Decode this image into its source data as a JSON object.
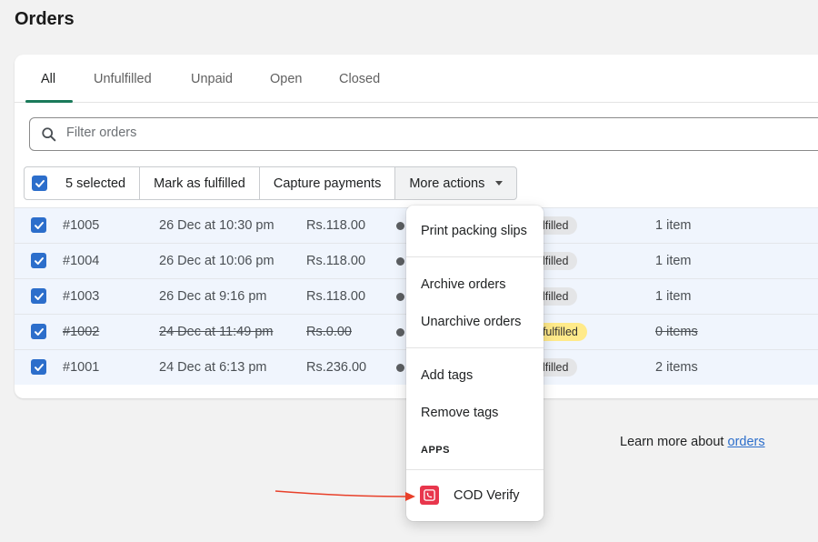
{
  "page": {
    "title": "Orders"
  },
  "tabs": [
    {
      "label": "All",
      "active": true
    },
    {
      "label": "Unfulfilled",
      "active": false
    },
    {
      "label": "Unpaid",
      "active": false
    },
    {
      "label": "Open",
      "active": false
    },
    {
      "label": "Closed",
      "active": false
    }
  ],
  "filter": {
    "placeholder": "Filter orders",
    "icon": "search-icon"
  },
  "bulk_actions": {
    "selected_label": "5 selected",
    "mark_fulfilled_label": "Mark as fulfilled",
    "capture_payments_label": "Capture payments",
    "more_actions_label": "More actions"
  },
  "orders": [
    {
      "id": "#1005",
      "date": "26 Dec at 10:30 pm",
      "total": "Rs.118.00",
      "fulfillment": "ulfilled",
      "items": "1 item",
      "checked": true,
      "struck": false
    },
    {
      "id": "#1004",
      "date": "26 Dec at 10:06 pm",
      "total": "Rs.118.00",
      "fulfillment": "ulfilled",
      "items": "1 item",
      "checked": true,
      "struck": false
    },
    {
      "id": "#1003",
      "date": "26 Dec at 9:16 pm",
      "total": "Rs.118.00",
      "fulfillment": "ulfilled",
      "items": "1 item",
      "checked": true,
      "struck": false
    },
    {
      "id": "#1002",
      "date": "24 Dec at 11:49 pm",
      "total": "Rs.0.00",
      "fulfillment": "nfulfilled",
      "items": "0 items",
      "checked": true,
      "struck": true
    },
    {
      "id": "#1001",
      "date": "24 Dec at 6:13 pm",
      "total": "Rs.236.00",
      "fulfillment": "ulfilled",
      "items": "2 items",
      "checked": true,
      "struck": false
    }
  ],
  "dropdown": {
    "print_packing_slips": "Print packing slips",
    "archive_orders": "Archive orders",
    "unarchive_orders": "Unarchive orders",
    "add_tags": "Add tags",
    "remove_tags": "Remove tags",
    "apps_heading": "APPS",
    "cod_verify": "COD Verify"
  },
  "footer": {
    "learn_more_text": "Learn more about ",
    "learn_more_link": "orders"
  },
  "colors": {
    "accent": "#2c6ecb",
    "tab_underline": "#1a7a5a",
    "app_icon": "#e8364c",
    "annotation_arrow": "#e8402a",
    "row_selected_bg": "#f0f5fd"
  }
}
